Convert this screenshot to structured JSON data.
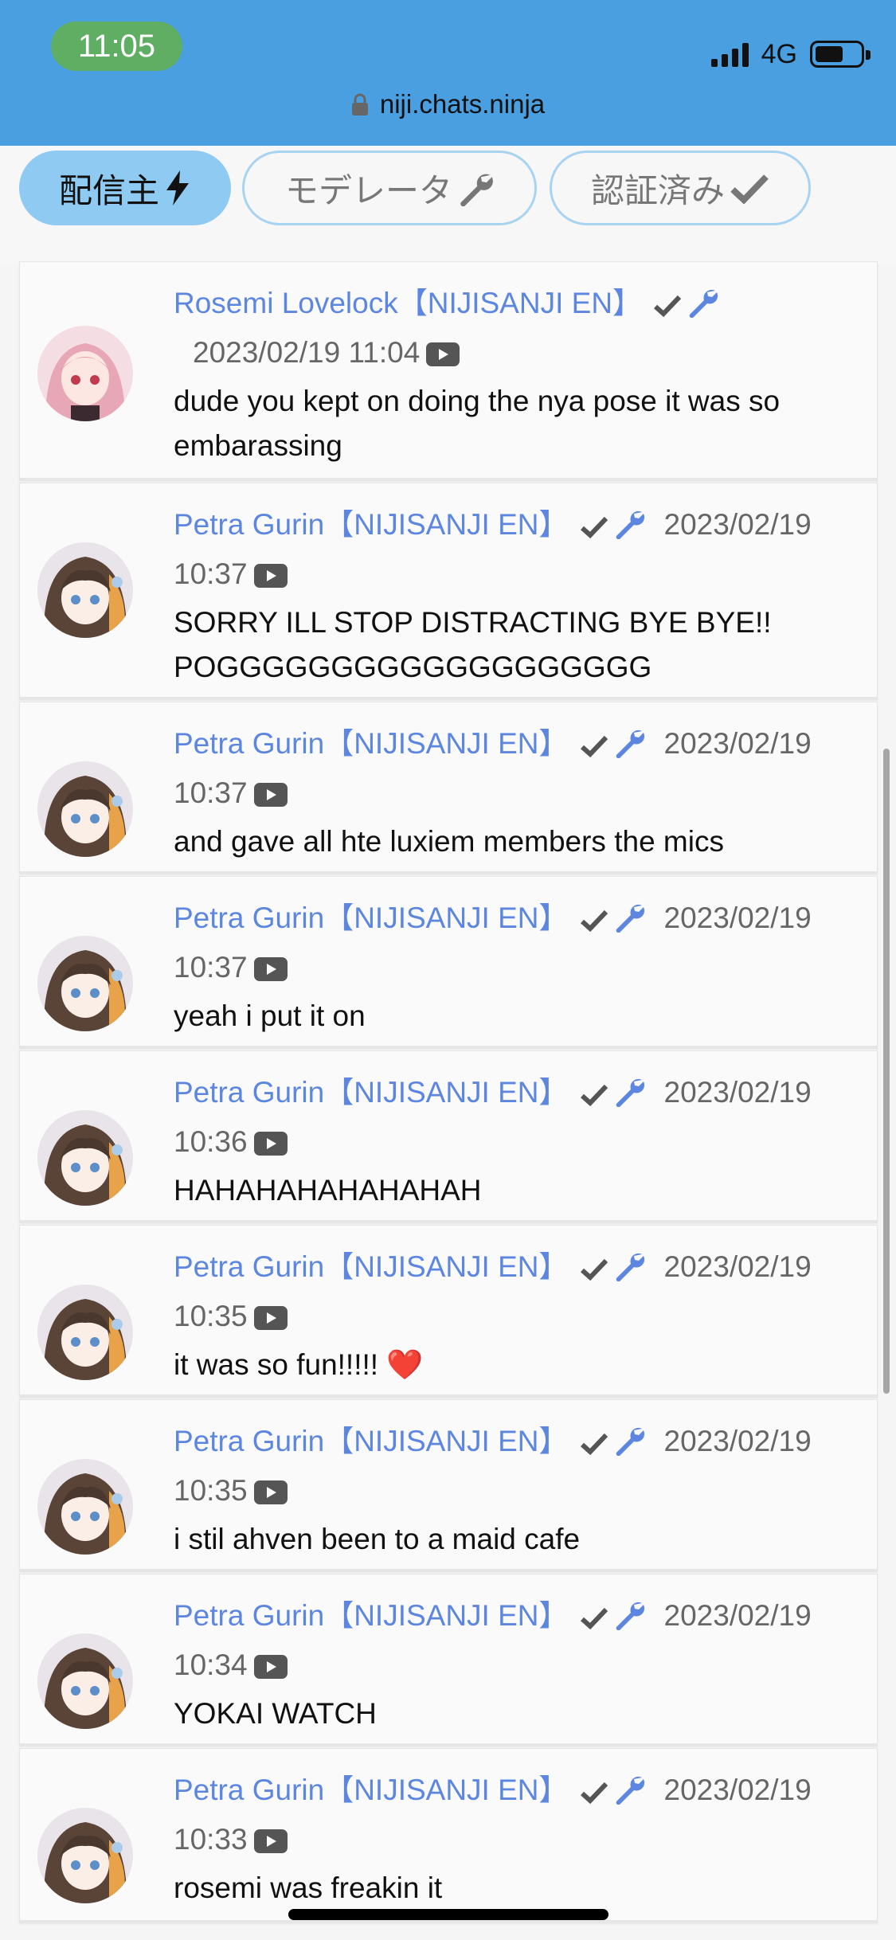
{
  "status_bar": {
    "time": "11:05",
    "network": "4G"
  },
  "browser": {
    "url": "niji.chats.ninja"
  },
  "filters": [
    {
      "label": "配信主",
      "icon": "lightning-icon",
      "active": true
    },
    {
      "label": "モデレータ",
      "icon": "wrench-icon",
      "active": false
    },
    {
      "label": "認証済み",
      "icon": "check-icon",
      "active": false
    }
  ],
  "colors": {
    "accent": "#4a9fe0",
    "name": "#5c86df",
    "active_filter": "#8fcaf2"
  },
  "messages": [
    {
      "author": "Rosemi Lovelock【NIJISANJI EN】",
      "date": "2023/02/19",
      "time": "11:04",
      "text": "dude you kept on doing the nya pose it was so embarassing",
      "avatar": "rosemi-avatar"
    },
    {
      "author": "Petra Gurin【NIJISANJI EN】",
      "date": "2023/02/19",
      "time": "10:37",
      "text": "SORRY ILL STOP DISTRACTING BYE BYE!! POGGGGGGGGGGGGGGGGGGG",
      "avatar": "petra-avatar"
    },
    {
      "author": "Petra Gurin【NIJISANJI EN】",
      "date": "2023/02/19",
      "time": "10:37",
      "text": "and gave all hte luxiem members the mics",
      "avatar": "petra-avatar"
    },
    {
      "author": "Petra Gurin【NIJISANJI EN】",
      "date": "2023/02/19",
      "time": "10:37",
      "text": "yeah i put it on",
      "avatar": "petra-avatar"
    },
    {
      "author": "Petra Gurin【NIJISANJI EN】",
      "date": "2023/02/19",
      "time": "10:36",
      "text": "HAHAHAHAHAHAHAH",
      "avatar": "petra-avatar"
    },
    {
      "author": "Petra Gurin【NIJISANJI EN】",
      "date": "2023/02/19",
      "time": "10:35",
      "text": "it was so fun!!!!! ❤️",
      "avatar": "petra-avatar"
    },
    {
      "author": "Petra Gurin【NIJISANJI EN】",
      "date": "2023/02/19",
      "time": "10:35",
      "text": "i stil ahven been to a maid cafe",
      "avatar": "petra-avatar"
    },
    {
      "author": "Petra Gurin【NIJISANJI EN】",
      "date": "2023/02/19",
      "time": "10:34",
      "text": "YOKAI WATCH",
      "avatar": "petra-avatar"
    },
    {
      "author": "Petra Gurin【NIJISANJI EN】",
      "date": "2023/02/19",
      "time": "10:33",
      "text": "rosemi was freakin it",
      "avatar": "petra-avatar"
    }
  ]
}
